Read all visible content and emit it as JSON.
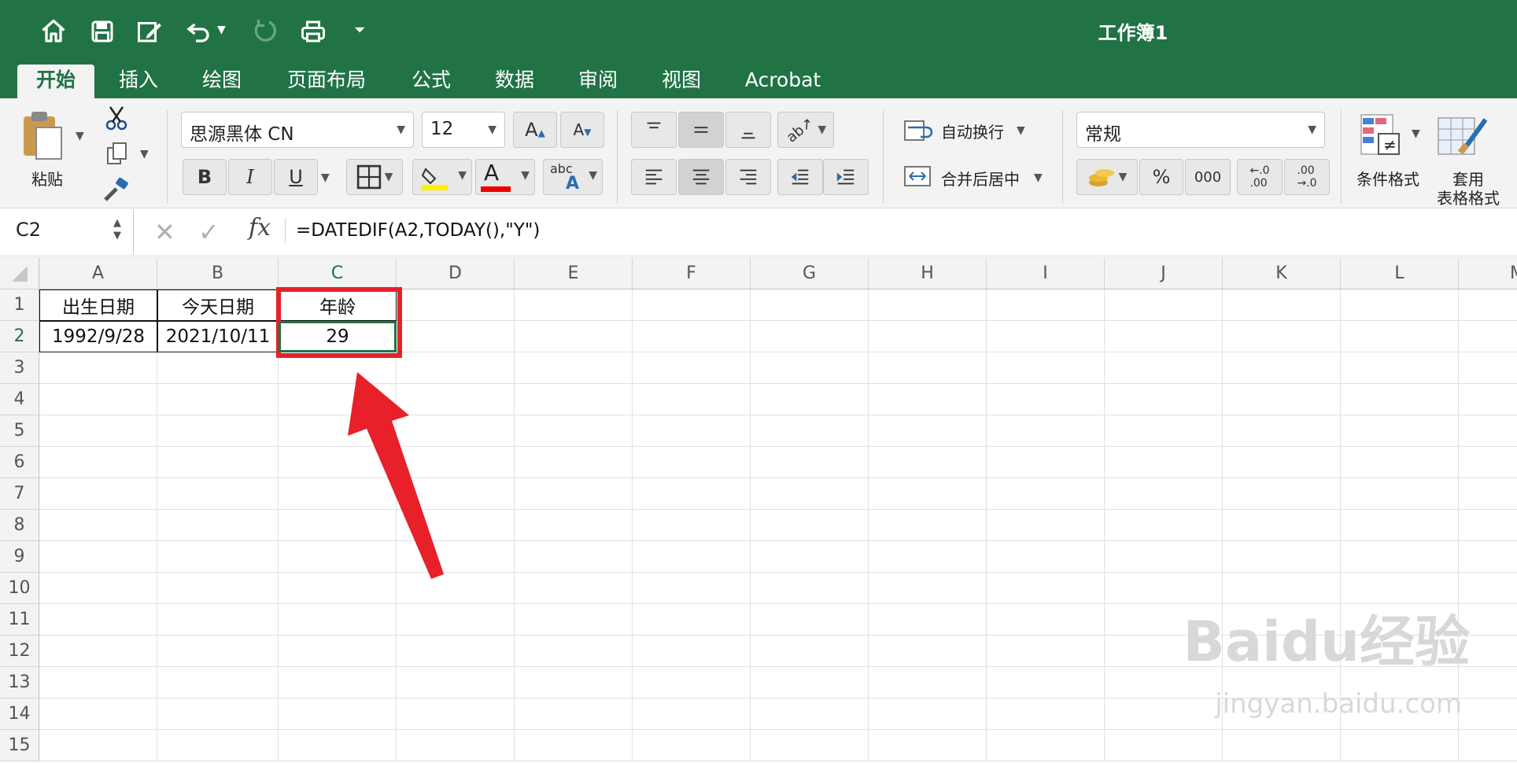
{
  "window": {
    "title": "工作簿1"
  },
  "quick_access": {
    "icons": [
      "home-icon",
      "save-icon",
      "edit-icon",
      "undo-icon",
      "redo-icon",
      "print-icon",
      "customize-icon"
    ]
  },
  "tabs": [
    {
      "label": "开始"
    },
    {
      "label": "插入"
    },
    {
      "label": "绘图"
    },
    {
      "label": "页面布局"
    },
    {
      "label": "公式"
    },
    {
      "label": "数据"
    },
    {
      "label": "审阅"
    },
    {
      "label": "视图"
    },
    {
      "label": "Acrobat"
    }
  ],
  "ribbon": {
    "paste_label": "粘贴",
    "font_name": "思源黑体 CN",
    "font_size": "12",
    "bold_label": "B",
    "italic_label": "I",
    "underline_label": "U",
    "font_color_letter": "A",
    "wrap_text": "自动换行",
    "merge_center": "合并后居中",
    "number_format": "常规",
    "percent": "%",
    "thousands": "000",
    "conditional_format": "条件格式",
    "format_table_line1": "套用",
    "format_table_line2": "表格格式",
    "abc_label": "abc"
  },
  "formula_bar": {
    "name_box": "C2",
    "fx": "fx",
    "formula": "=DATEDIF(A2,TODAY(),\"Y\")"
  },
  "grid": {
    "columns": [
      "A",
      "B",
      "C",
      "D",
      "E",
      "F",
      "G",
      "H",
      "I",
      "J",
      "K",
      "L",
      "M"
    ],
    "rows": [
      "1",
      "2",
      "3",
      "4",
      "5",
      "6",
      "7",
      "8",
      "9",
      "10",
      "11",
      "12",
      "13",
      "14",
      "15"
    ],
    "cells": {
      "A1": "出生日期",
      "B1": "今天日期",
      "C1": "年龄",
      "A2": "1992/9/28",
      "B2": "2021/10/11",
      "C2": "29"
    }
  },
  "colors": {
    "accent": "#217346",
    "annotation": "#e8202a"
  },
  "watermark": {
    "text": "Baidu经验",
    "url": "jingyan.baidu.com"
  }
}
